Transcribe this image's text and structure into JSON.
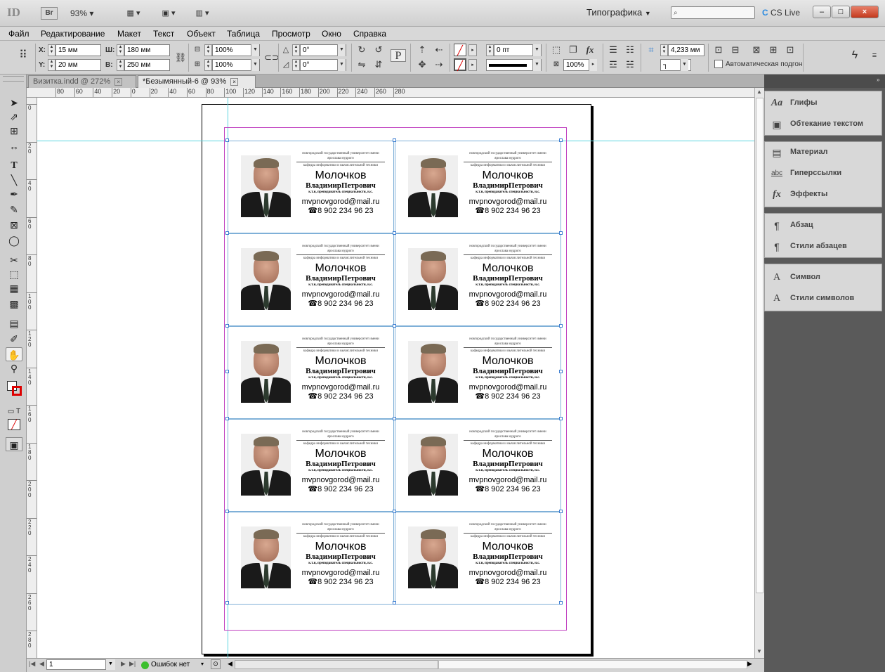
{
  "title_bar": {
    "app_logo": "ID",
    "bridge_label": "Br",
    "zoom": "93%",
    "workspace": "Типографика",
    "cs_live": "CS Live",
    "search_placeholder": "",
    "min_label": "–",
    "max_label": "□",
    "close_label": "×"
  },
  "menu": [
    "Файл",
    "Редактирование",
    "Макет",
    "Текст",
    "Объект",
    "Таблица",
    "Просмотр",
    "Окно",
    "Справка"
  ],
  "control_panel": {
    "x_label": "X:",
    "y_label": "Y:",
    "x_value": "15 мм",
    "y_value": "20 мм",
    "w_label": "Ш:",
    "h_label": "В:",
    "w_value": "180 мм",
    "h_value": "250 мм",
    "scale_x": "100%",
    "scale_y": "100%",
    "rotate": "0°",
    "shear": "0°",
    "stroke_weight": "0 пт",
    "opacity": "100%",
    "offset": "4,233 мм",
    "auto_fit_label": "Автоматическая подгон"
  },
  "doc_tabs": [
    {
      "label": "Визитка.indd @ 272%",
      "active": false
    },
    {
      "label": "*Безымянный-6 @ 93%",
      "active": true
    }
  ],
  "ruler_h_labels": [
    "80",
    "60",
    "40",
    "20",
    "0",
    "20",
    "40",
    "60",
    "80",
    "100",
    "120",
    "140",
    "160",
    "180",
    "200",
    "220",
    "240",
    "260",
    "280"
  ],
  "ruler_v_labels": [
    "0",
    "2 0",
    "4 0",
    "6 0",
    "8 0",
    "1 0 0",
    "1 2 0",
    "1 4 0",
    "1 6 0",
    "1 8 0",
    "2 0 0",
    "2 2 0",
    "2 4 0",
    "2 6 0",
    "2 8 0"
  ],
  "card": {
    "university_line1": "новгородский государственный университет имени",
    "university_line2": "ярослава мудрого",
    "department": "кафедра информатики и вычислительной техники",
    "surname": "Молочков",
    "name": "ВладимирПетрович",
    "degree": "к.т.н, преподаватель специальности, н.с.",
    "email": "mvpnovgorod@mail.ru",
    "phone": "☎8 902 234 96 23"
  },
  "status_bar": {
    "page": "1",
    "errors": "Ошибок нет"
  },
  "right_panel": {
    "groups": [
      {
        "items": [
          {
            "icon": "Aa",
            "label": "Глифы"
          },
          {
            "icon": "▣",
            "label": "Обтекание текстом"
          }
        ]
      },
      {
        "items": [
          {
            "icon": "▤",
            "label": "Материал"
          },
          {
            "icon": "abc",
            "label": "Гиперссылки"
          },
          {
            "icon": "fx",
            "label": "Эффекты"
          }
        ]
      },
      {
        "items": [
          {
            "icon": "¶",
            "label": "Абзац"
          },
          {
            "icon": "¶",
            "label": "Стили абзацев"
          }
        ]
      },
      {
        "items": [
          {
            "icon": "A",
            "label": "Символ"
          },
          {
            "icon": "A",
            "label": "Стили символов"
          }
        ]
      }
    ]
  }
}
